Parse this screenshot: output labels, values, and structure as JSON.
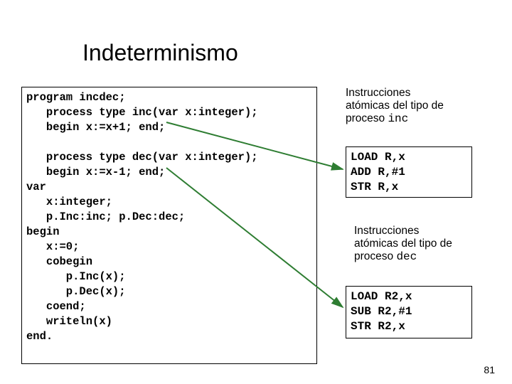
{
  "title": "Indeterminismo",
  "main_code": "program incdec;\n   process type inc(var x:integer);\n   begin x:=x+1; end;\n\n   process type dec(var x:integer);\n   begin x:=x-1; end;\nvar\n   x:integer;\n   p.Inc:inc; p.Dec:dec;\nbegin\n   x:=0;\n   cobegin\n      p.Inc(x);\n      p.Dec(x);\n   coend;\n   writeln(x)\nend.",
  "inc_label_a": "Instrucciones",
  "inc_label_b": "atómicas del tipo de",
  "inc_label_c": "proceso ",
  "inc_label_mono": "inc",
  "dec_label_a": "Instrucciones",
  "dec_label_b": "atómicas del tipo de",
  "dec_label_c": "proceso ",
  "dec_label_mono": "dec",
  "inc_code": "LOAD R,x\nADD R,#1\nSTR R,x",
  "dec_code": "LOAD R2,x\nSUB R2,#1\nSTR R2,x",
  "page_number": "81"
}
